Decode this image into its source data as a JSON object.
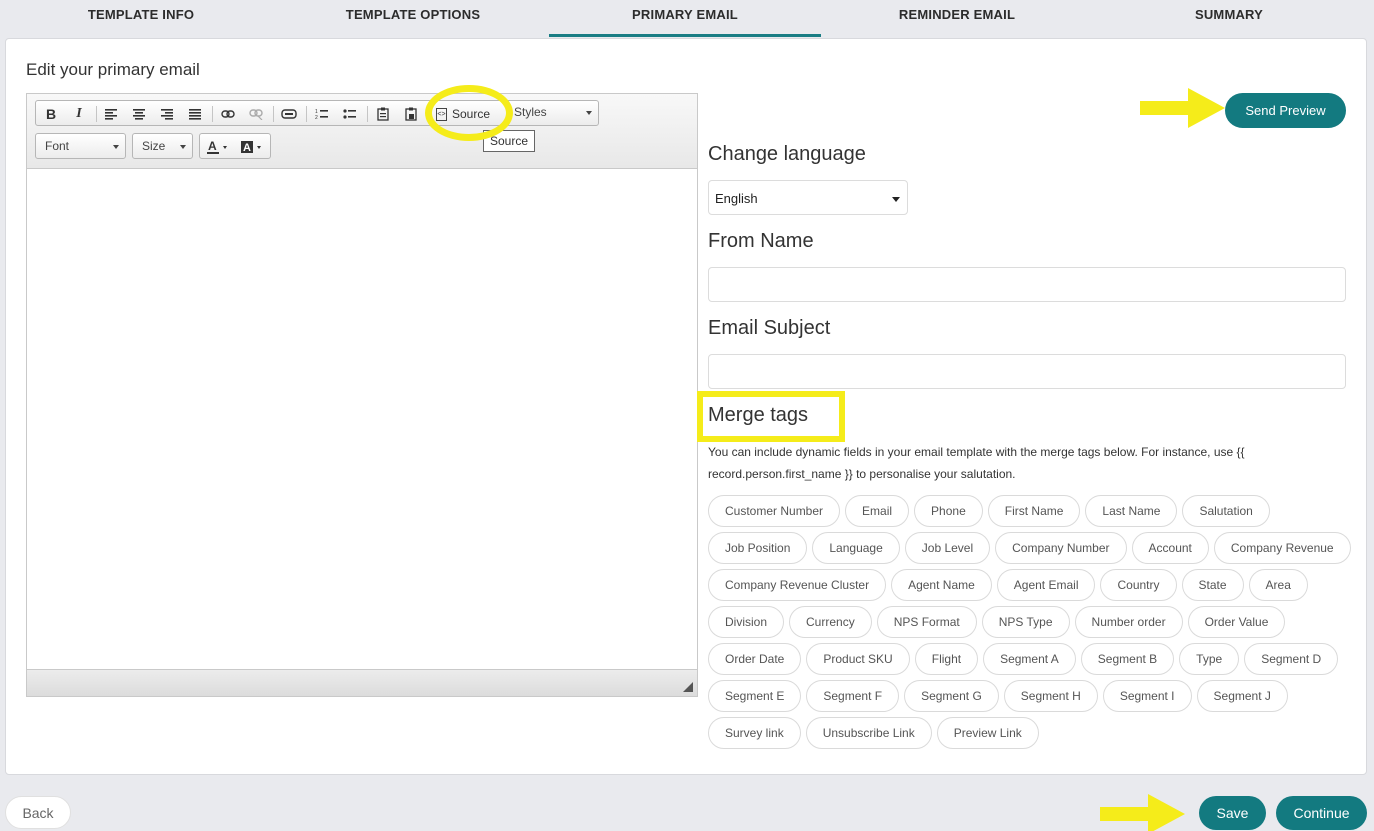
{
  "tabs": [
    {
      "label": "TEMPLATE INFO"
    },
    {
      "label": "TEMPLATE OPTIONS"
    },
    {
      "label": "PRIMARY EMAIL"
    },
    {
      "label": "REMINDER EMAIL"
    },
    {
      "label": "SUMMARY"
    }
  ],
  "active_tab": "PRIMARY EMAIL",
  "editor": {
    "title": "Edit your primary email",
    "toolbar": {
      "bold": "B",
      "italic": "I",
      "source_label": "Source",
      "styles_label": "Styles",
      "font_label": "Font",
      "size_label": "Size",
      "tooltip": "Source"
    }
  },
  "send_preview_label": "Send Preview",
  "change_language": {
    "heading": "Change language",
    "selected": "English"
  },
  "from_name": {
    "heading": "From Name",
    "value": ""
  },
  "email_subject": {
    "heading": "Email Subject",
    "value": ""
  },
  "merge_tags": {
    "heading": "Merge tags",
    "description": "You can include dynamic fields in your email template with the merge tags below. For instance, use {{ record.person.first_name }} to personalise your salutation.",
    "tags": [
      "Customer Number",
      "Email",
      "Phone",
      "First Name",
      "Last Name",
      "Salutation",
      "Job Position",
      "Language",
      "Job Level",
      "Company Number",
      "Account",
      "Company Revenue",
      "Company Revenue Cluster",
      "Agent Name",
      "Agent Email",
      "Country",
      "State",
      "Area",
      "Division",
      "Currency",
      "NPS Format",
      "NPS Type",
      "Number order",
      "Order Value",
      "Order Date",
      "Product SKU",
      "Flight",
      "Segment A",
      "Segment B",
      "Type",
      "Segment D",
      "Segment E",
      "Segment F",
      "Segment G",
      "Segment H",
      "Segment I",
      "Segment J",
      "Survey link",
      "Unsubscribe Link",
      "Preview Link"
    ]
  },
  "footer": {
    "back_label": "Back",
    "save_label": "Save",
    "continue_label": "Continue"
  },
  "colors": {
    "accent": "#137a80",
    "annotation": "#f5ec1a"
  }
}
